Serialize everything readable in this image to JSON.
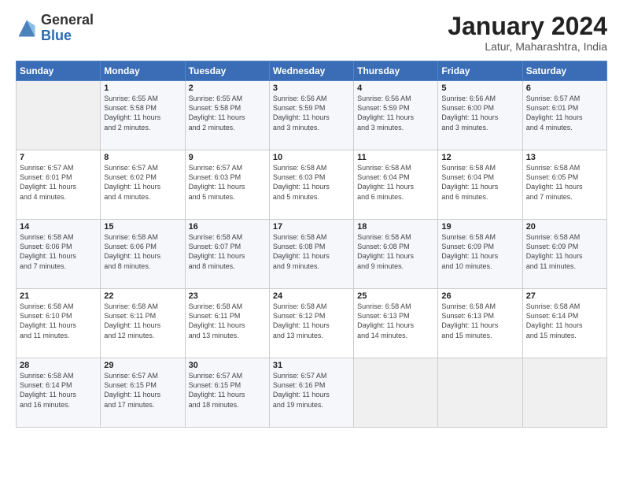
{
  "app": {
    "logo_general": "General",
    "logo_blue": "Blue"
  },
  "header": {
    "month_title": "January 2024",
    "location": "Latur, Maharashtra, India"
  },
  "calendar": {
    "days_of_week": [
      "Sunday",
      "Monday",
      "Tuesday",
      "Wednesday",
      "Thursday",
      "Friday",
      "Saturday"
    ],
    "weeks": [
      [
        {
          "day": "",
          "info": ""
        },
        {
          "day": "1",
          "info": "Sunrise: 6:55 AM\nSunset: 5:58 PM\nDaylight: 11 hours\nand 2 minutes."
        },
        {
          "day": "2",
          "info": "Sunrise: 6:55 AM\nSunset: 5:58 PM\nDaylight: 11 hours\nand 2 minutes."
        },
        {
          "day": "3",
          "info": "Sunrise: 6:56 AM\nSunset: 5:59 PM\nDaylight: 11 hours\nand 3 minutes."
        },
        {
          "day": "4",
          "info": "Sunrise: 6:56 AM\nSunset: 5:59 PM\nDaylight: 11 hours\nand 3 minutes."
        },
        {
          "day": "5",
          "info": "Sunrise: 6:56 AM\nSunset: 6:00 PM\nDaylight: 11 hours\nand 3 minutes."
        },
        {
          "day": "6",
          "info": "Sunrise: 6:57 AM\nSunset: 6:01 PM\nDaylight: 11 hours\nand 4 minutes."
        }
      ],
      [
        {
          "day": "7",
          "info": "Sunrise: 6:57 AM\nSunset: 6:01 PM\nDaylight: 11 hours\nand 4 minutes."
        },
        {
          "day": "8",
          "info": "Sunrise: 6:57 AM\nSunset: 6:02 PM\nDaylight: 11 hours\nand 4 minutes."
        },
        {
          "day": "9",
          "info": "Sunrise: 6:57 AM\nSunset: 6:03 PM\nDaylight: 11 hours\nand 5 minutes."
        },
        {
          "day": "10",
          "info": "Sunrise: 6:58 AM\nSunset: 6:03 PM\nDaylight: 11 hours\nand 5 minutes."
        },
        {
          "day": "11",
          "info": "Sunrise: 6:58 AM\nSunset: 6:04 PM\nDaylight: 11 hours\nand 6 minutes."
        },
        {
          "day": "12",
          "info": "Sunrise: 6:58 AM\nSunset: 6:04 PM\nDaylight: 11 hours\nand 6 minutes."
        },
        {
          "day": "13",
          "info": "Sunrise: 6:58 AM\nSunset: 6:05 PM\nDaylight: 11 hours\nand 7 minutes."
        }
      ],
      [
        {
          "day": "14",
          "info": "Sunrise: 6:58 AM\nSunset: 6:06 PM\nDaylight: 11 hours\nand 7 minutes."
        },
        {
          "day": "15",
          "info": "Sunrise: 6:58 AM\nSunset: 6:06 PM\nDaylight: 11 hours\nand 8 minutes."
        },
        {
          "day": "16",
          "info": "Sunrise: 6:58 AM\nSunset: 6:07 PM\nDaylight: 11 hours\nand 8 minutes."
        },
        {
          "day": "17",
          "info": "Sunrise: 6:58 AM\nSunset: 6:08 PM\nDaylight: 11 hours\nand 9 minutes."
        },
        {
          "day": "18",
          "info": "Sunrise: 6:58 AM\nSunset: 6:08 PM\nDaylight: 11 hours\nand 9 minutes."
        },
        {
          "day": "19",
          "info": "Sunrise: 6:58 AM\nSunset: 6:09 PM\nDaylight: 11 hours\nand 10 minutes."
        },
        {
          "day": "20",
          "info": "Sunrise: 6:58 AM\nSunset: 6:09 PM\nDaylight: 11 hours\nand 11 minutes."
        }
      ],
      [
        {
          "day": "21",
          "info": "Sunrise: 6:58 AM\nSunset: 6:10 PM\nDaylight: 11 hours\nand 11 minutes."
        },
        {
          "day": "22",
          "info": "Sunrise: 6:58 AM\nSunset: 6:11 PM\nDaylight: 11 hours\nand 12 minutes."
        },
        {
          "day": "23",
          "info": "Sunrise: 6:58 AM\nSunset: 6:11 PM\nDaylight: 11 hours\nand 13 minutes."
        },
        {
          "day": "24",
          "info": "Sunrise: 6:58 AM\nSunset: 6:12 PM\nDaylight: 11 hours\nand 13 minutes."
        },
        {
          "day": "25",
          "info": "Sunrise: 6:58 AM\nSunset: 6:13 PM\nDaylight: 11 hours\nand 14 minutes."
        },
        {
          "day": "26",
          "info": "Sunrise: 6:58 AM\nSunset: 6:13 PM\nDaylight: 11 hours\nand 15 minutes."
        },
        {
          "day": "27",
          "info": "Sunrise: 6:58 AM\nSunset: 6:14 PM\nDaylight: 11 hours\nand 15 minutes."
        }
      ],
      [
        {
          "day": "28",
          "info": "Sunrise: 6:58 AM\nSunset: 6:14 PM\nDaylight: 11 hours\nand 16 minutes."
        },
        {
          "day": "29",
          "info": "Sunrise: 6:57 AM\nSunset: 6:15 PM\nDaylight: 11 hours\nand 17 minutes."
        },
        {
          "day": "30",
          "info": "Sunrise: 6:57 AM\nSunset: 6:15 PM\nDaylight: 11 hours\nand 18 minutes."
        },
        {
          "day": "31",
          "info": "Sunrise: 6:57 AM\nSunset: 6:16 PM\nDaylight: 11 hours\nand 19 minutes."
        },
        {
          "day": "",
          "info": ""
        },
        {
          "day": "",
          "info": ""
        },
        {
          "day": "",
          "info": ""
        }
      ]
    ]
  }
}
